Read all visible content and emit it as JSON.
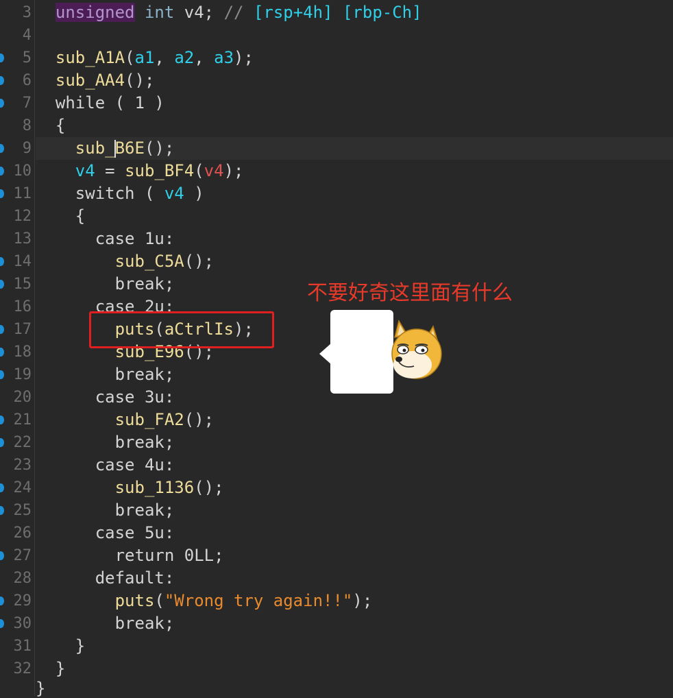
{
  "line_numbers": [
    "3",
    "4",
    "5",
    "6",
    "7",
    "8",
    "9",
    "10",
    "11",
    "12",
    "13",
    "14",
    "15",
    "16",
    "17",
    "18",
    "19",
    "20",
    "21",
    "22",
    "23",
    "24",
    "25",
    "26",
    "27",
    "28",
    "29",
    "30",
    "31",
    "32"
  ],
  "breakpoint_lines": [
    "5",
    "6",
    "7",
    "9",
    "10",
    "11",
    "14",
    "15",
    "17",
    "18",
    "19",
    "21",
    "22",
    "24",
    "25",
    "27",
    "29",
    "30"
  ],
  "code": {
    "l3_kw": "unsigned",
    "l3_type": "int",
    "l3_var": "v4;",
    "l3_comment": "//",
    "l3_c1": "[rsp+4h]",
    "l3_c2": "[rbp-Ch]",
    "l5_fn": "sub_A1A",
    "l5_a1": "a1",
    "l5_a2": "a2",
    "l5_a3": "a3",
    "l6_fn": "sub_AA4",
    "l7_kw": "while",
    "l7_num": "1",
    "l8": "{",
    "l9_a": "sub_",
    "l9_b": "B6E",
    "l10_var": "v4",
    "l10_fn": "sub_BF4",
    "l10_arg": "v4",
    "l11_kw": "switch",
    "l11_var": "v4",
    "l12": "{",
    "l13": "case 1u:",
    "l14_fn": "sub_C5A",
    "l15": "break;",
    "l16": "case 2u:",
    "l17_fn": "puts",
    "l17_arg": "aCtrlIs",
    "l18_fn": "sub_E96",
    "l19": "break;",
    "l20": "case 3u:",
    "l21_fn": "sub_FA2",
    "l22": "break;",
    "l23": "case 4u:",
    "l24_fn": "sub_1136",
    "l25": "break;",
    "l26": "case 5u:",
    "l27": "return 0LL;",
    "l28": "default:",
    "l29_fn": "puts",
    "l29_str": "\"Wrong try again!!\"",
    "l30": "break;",
    "l31": "}",
    "l32": "}",
    "l33": "}"
  },
  "annotation": {
    "text": "不要好奇这里面有什么",
    "color": "#e83a2a",
    "box_color": "#e02020"
  },
  "sticker": {
    "icon": "doge-face-icon"
  }
}
